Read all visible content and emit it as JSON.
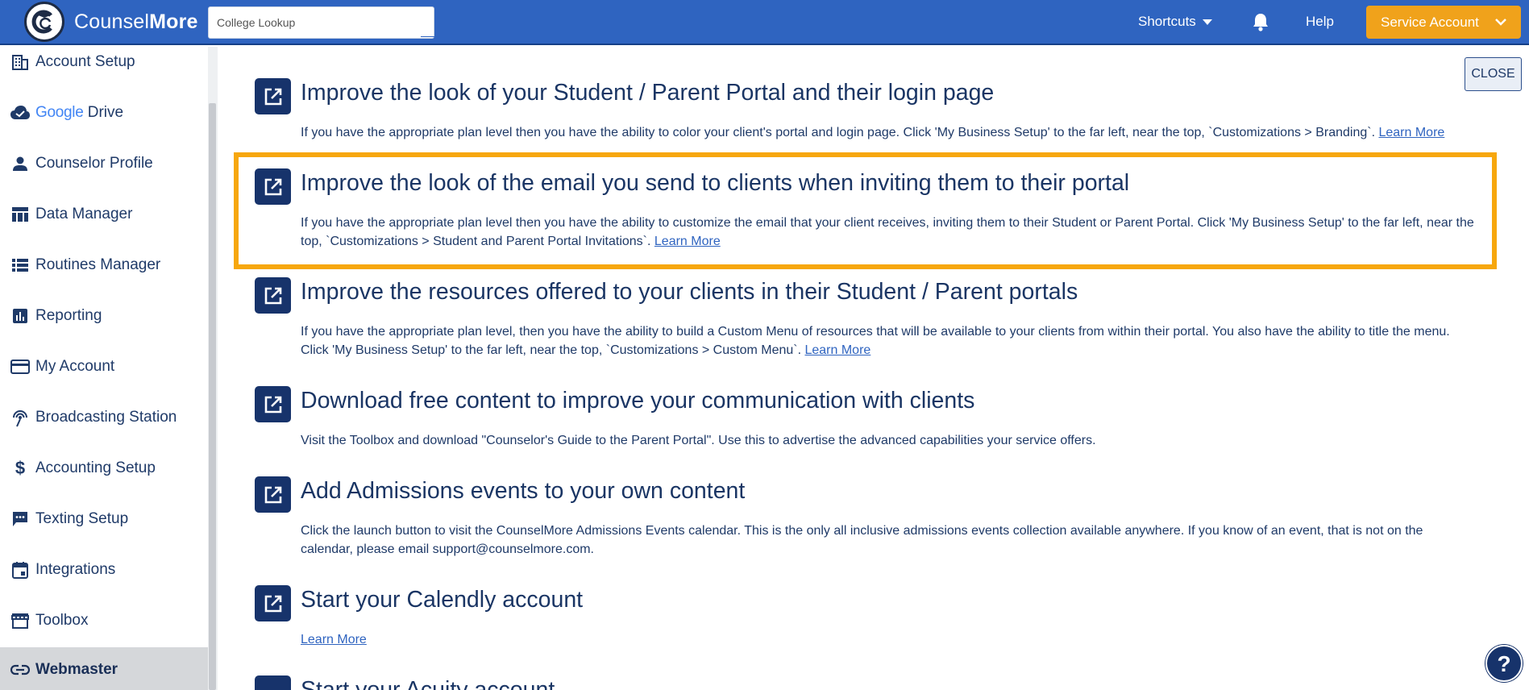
{
  "header": {
    "brand_light": "Counsel",
    "brand_bold": "More",
    "search_value": "College Lookup",
    "shortcuts_label": "Shortcuts",
    "help_label": "Help",
    "account_label": "Service Account"
  },
  "sidebar": {
    "items": [
      {
        "label": "Account Setup",
        "icon": "building-icon"
      },
      {
        "label_google": "Google",
        "label": "Drive",
        "icon": "cloud-check-icon"
      },
      {
        "label": "Counselor Profile",
        "icon": "person-icon"
      },
      {
        "label": "Data Manager",
        "icon": "table-icon"
      },
      {
        "label": "Routines Manager",
        "icon": "list-icon"
      },
      {
        "label": "Reporting",
        "icon": "bar-chart-icon"
      },
      {
        "label": "My Account",
        "icon": "credit-card-icon"
      },
      {
        "label": "Broadcasting Station",
        "icon": "broadcast-icon"
      },
      {
        "label": "Accounting Setup",
        "icon": "dollar-icon"
      },
      {
        "label": "Texting Setup",
        "icon": "chat-icon"
      },
      {
        "label": "Integrations",
        "icon": "calendar-icon"
      },
      {
        "label": "Toolbox",
        "icon": "store-icon"
      },
      {
        "label": "Webmaster",
        "icon": "link-icon"
      }
    ],
    "active": "Webmaster"
  },
  "main": {
    "close_label": "CLOSE",
    "tasks": [
      {
        "title": "Improve the look of your Student / Parent Portal and their login page",
        "desc": "If you have the appropriate plan level then you have the ability to color your client's portal and login page. Click 'My Business Setup' to the far left, near the top, `Customizations > Branding`. ",
        "link": "Learn More"
      },
      {
        "title": "Improve the look of the email you send to clients when inviting them to their portal",
        "desc": "If you have the appropriate plan level then you have the ability to customize the email that your client receives, inviting them to their Student or Parent Portal. Click 'My Business Setup' to the far left, near the top, `Customizations > Student and Parent Portal Invitations`. ",
        "link": "Learn More"
      },
      {
        "title": "Improve the resources offered to your clients in their Student / Parent portals",
        "desc": "If you have the appropriate plan level, then you have the ability to build a Custom Menu of resources that will be available to your clients from within their portal. You also have the ability to title the menu. Click 'My Business Setup' to the far left, near the top, `Customizations > Custom Menu`. ",
        "link": "Learn More"
      },
      {
        "title": "Download free content to improve your communication with clients",
        "desc": "Visit the Toolbox and download \"Counselor's Guide to the Parent Portal\". Use this to advertise the advanced capabilities your service offers.",
        "link": ""
      },
      {
        "title": "Add Admissions events to your own content",
        "desc": "Click the launch button to visit the CounselMore Admissions Events calendar. This is the only all inclusive admissions events collection available anywhere. If you know of an event, that is not on the calendar, please email support@counselmore.com.",
        "link": ""
      },
      {
        "title": "Start your Calendly account",
        "desc": "",
        "link": "Learn More"
      },
      {
        "title": "Start your Acuity account",
        "desc": "",
        "link": ""
      }
    ]
  },
  "help_fab": "?",
  "colors": {
    "header_blue": "#2f64c0",
    "navy": "#17336b",
    "orange": "#f0a21b",
    "highlight": "#f7a70d"
  }
}
